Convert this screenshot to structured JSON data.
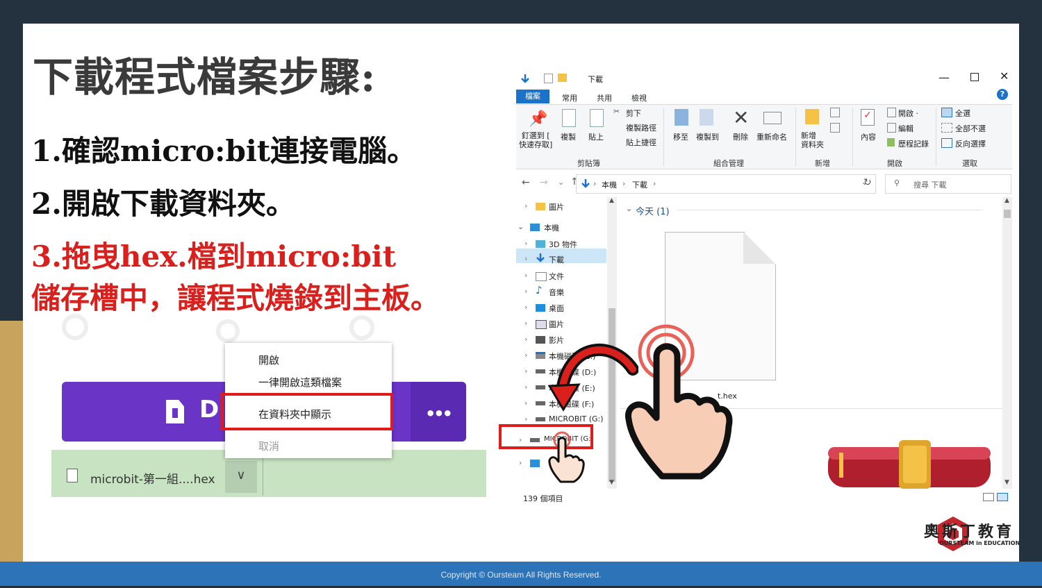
{
  "slide": {
    "title": "下載程式檔案步驟:",
    "step1": "1.確認micro:bit連接電腦。",
    "step2": "2.開啟下載資料夾。",
    "step3_line1": "3.拖曳hex.檔到micro:bit",
    "step3_line2": "儲存槽中，讓程式燒錄到主板。"
  },
  "browser": {
    "download_button_label": "D",
    "more_button_label": "•••",
    "download_file_name": "microbit-第一組....hex",
    "chevron": "∨"
  },
  "context_menu": {
    "items": [
      "開啟",
      "一律開啟這類檔案",
      "在資料夾中顯示",
      "取消"
    ],
    "highlighted": "在資料夾中顯示"
  },
  "explorer": {
    "window_title": "下載",
    "tabs": [
      "檔案",
      "常用",
      "共用",
      "檢視"
    ],
    "ribbon": {
      "pin": "釘選到 [\n快速存取]",
      "copy": "複製",
      "paste": "貼上",
      "cut": "剪下",
      "copy_path": "複製路徑",
      "paste_shortcut": "貼上捷徑",
      "move_to": "移至",
      "copy_to": "複製到",
      "delete": "刪除",
      "rename": "重新命名",
      "new_folder": "新增\n資料夾",
      "properties": "內容",
      "open": "開啟 ·",
      "edit": "編輯",
      "history": "歷程記錄",
      "select_all": "全選",
      "select_none": "全部不選",
      "invert_selection": "反向選擇",
      "groups": [
        "剪貼簿",
        "組合管理",
        "新增",
        "開啟",
        "選取"
      ]
    },
    "address_path": [
      "本機",
      "下載"
    ],
    "search_placeholder": "搜尋 下載",
    "nav_items": [
      "圖片",
      "本機",
      "3D 物件",
      "下載",
      "文件",
      "音樂",
      "桌面",
      "圖片",
      "影片",
      "本機磁碟 (C:)",
      "本機磁碟 (D:)",
      "本機磁碟 (E:)",
      "本機磁碟 (F:)",
      "MICROBIT (G:)",
      "MICROBIT (G:)"
    ],
    "group_header": "今天 (1)",
    "file_label_partial": "t.hex",
    "status": "139 個項目"
  },
  "logo": {
    "name": "奧斯丁教育",
    "tagline": "OURSTEAM in EDUCATION"
  },
  "footer": {
    "copyright": "Copyright © Oursteam All Rights Reserved."
  },
  "colors": {
    "accent_red": "#d9201c",
    "purple": "#6a34c7",
    "footer_blue": "#2d73b8",
    "explorer_blue": "#1a73c9"
  }
}
